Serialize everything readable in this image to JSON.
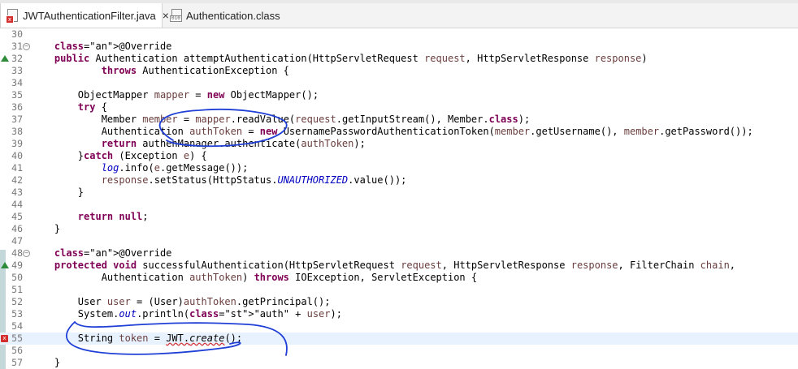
{
  "tabs": [
    {
      "label": "JWTAuthenticationFilter.java",
      "close": "×",
      "active": true
    },
    {
      "label": "Authentication.class",
      "active": false
    }
  ],
  "colors": {
    "keyword": "#7f0055",
    "annotation": "#646464",
    "param": "#6a3e3e",
    "field": "#0000c0",
    "string": "#2a00ff",
    "current_line": "#e8f2fe",
    "override_marker": "#2e8b3a",
    "error": "#d32f2f",
    "pen": "#1f3fd6"
  },
  "icons": {
    "tab1": "java-file-error-icon",
    "tab2": "class-file-icon"
  },
  "code": [
    {
      "n": "30",
      "text": ""
    },
    {
      "n": "31",
      "text": "    @Override",
      "fold": "−"
    },
    {
      "n": "32",
      "text": "    public Authentication attemptAuthentication(HttpServletRequest request, HttpServletResponse response)",
      "marker": "override"
    },
    {
      "n": "33",
      "text": "            throws AuthenticationException {"
    },
    {
      "n": "34",
      "text": ""
    },
    {
      "n": "35",
      "text": "        ObjectMapper mapper = new ObjectMapper();"
    },
    {
      "n": "36",
      "text": "        try {"
    },
    {
      "n": "37",
      "text": "            Member member = mapper.readValue(request.getInputStream(), Member.class);"
    },
    {
      "n": "38",
      "text": "            Authentication authToken = new UsernamePasswordAuthenticationToken(member.getUsername(), member.getPassword());"
    },
    {
      "n": "39",
      "text": "            return authenManager.authenticate(authToken);"
    },
    {
      "n": "40",
      "text": "        }catch (Exception e) {"
    },
    {
      "n": "41",
      "text": "            log.info(e.getMessage());"
    },
    {
      "n": "42",
      "text": "            response.setStatus(HttpStatus.UNAUTHORIZED.value());"
    },
    {
      "n": "43",
      "text": "        }"
    },
    {
      "n": "44",
      "text": ""
    },
    {
      "n": "45",
      "text": "        return null;"
    },
    {
      "n": "46",
      "text": "    }"
    },
    {
      "n": "47",
      "text": ""
    },
    {
      "n": "48",
      "text": "    @Override",
      "fold": "−"
    },
    {
      "n": "49",
      "text": "    protected void successfulAuthentication(HttpServletRequest request, HttpServletResponse response, FilterChain chain,",
      "marker": "override"
    },
    {
      "n": "50",
      "text": "            Authentication authToken) throws IOException, ServletException {"
    },
    {
      "n": "51",
      "text": ""
    },
    {
      "n": "52",
      "text": "        User user = (User)authToken.getPrincipal();"
    },
    {
      "n": "53",
      "text": "        System.out.println(\"auth\" + user);"
    },
    {
      "n": "54",
      "text": ""
    },
    {
      "n": "55",
      "text": "        String token = JWT.create();",
      "marker": "error",
      "current": true
    },
    {
      "n": "56",
      "text": ""
    },
    {
      "n": "57",
      "text": "    }"
    }
  ]
}
